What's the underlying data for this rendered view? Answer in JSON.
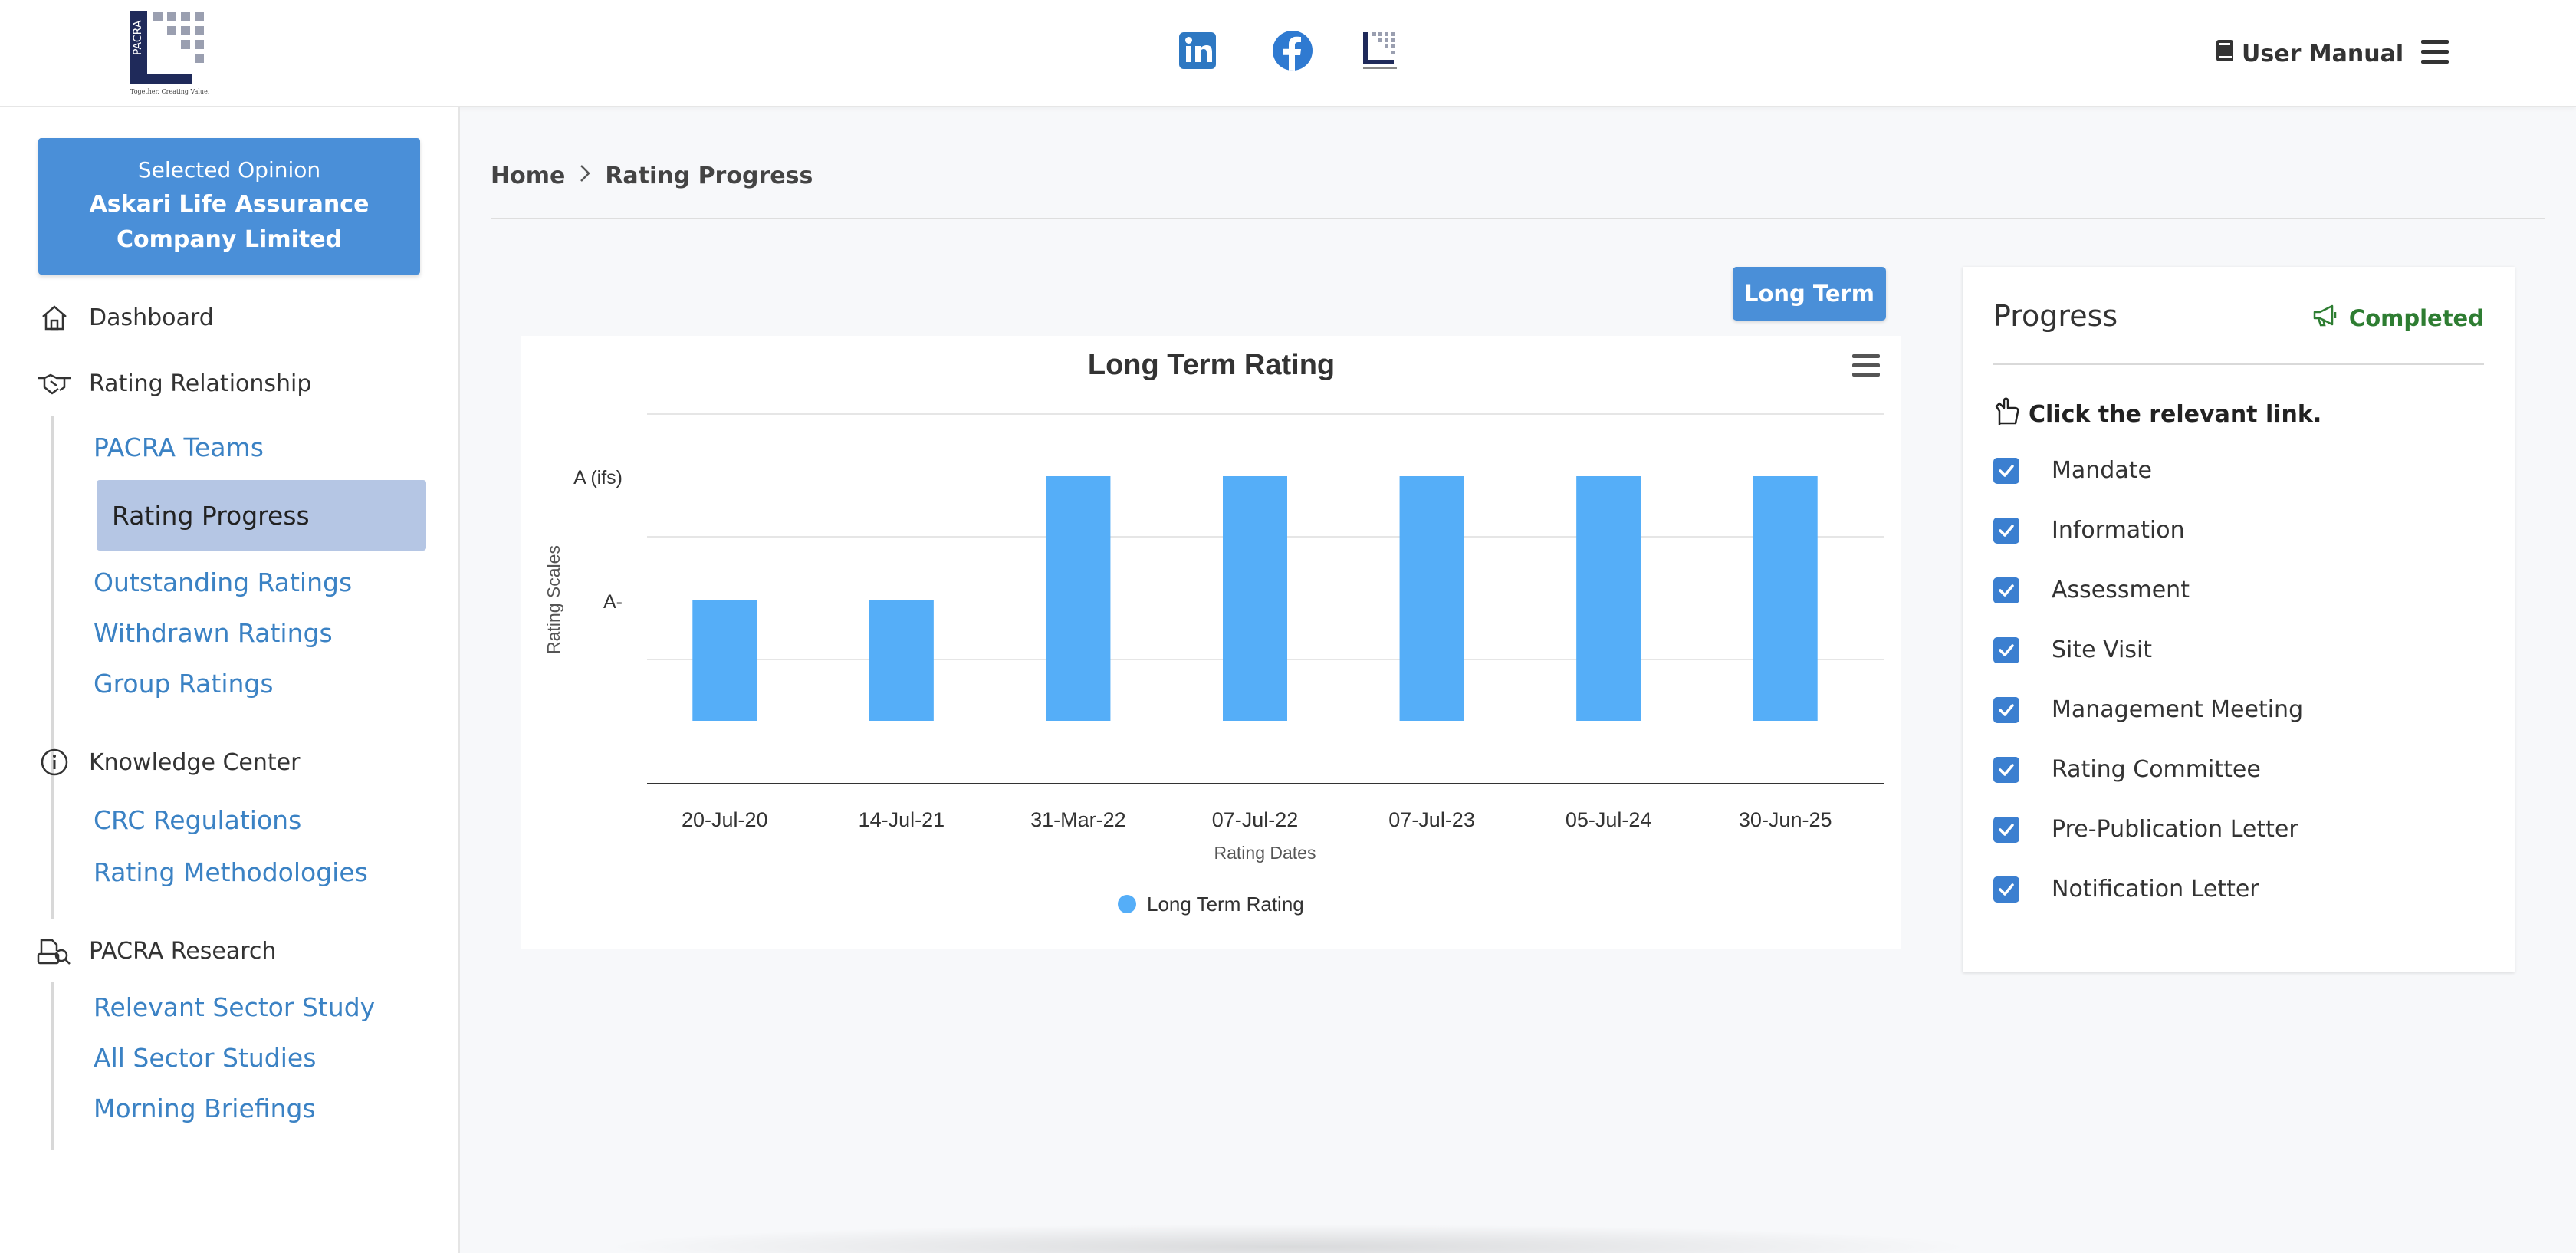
{
  "header": {
    "logo_text": "PACRA",
    "logo_tagline": "Together. Creating Value.",
    "user_manual_label": "User Manual"
  },
  "sidebar": {
    "selected_opinion_label": "Selected Opinion",
    "selected_opinion_name": "Askari Life Assurance Company Limited",
    "dashboard_label": "Dashboard",
    "rating_relationship": {
      "label": "Rating Relationship",
      "items": [
        "PACRA Teams",
        "Rating Progress",
        "Outstanding Ratings",
        "Withdrawn Ratings",
        "Group Ratings"
      ]
    },
    "knowledge_center": {
      "label": "Knowledge Center",
      "items": [
        "CRC Regulations",
        "Rating Methodologies"
      ]
    },
    "pacra_research": {
      "label": "PACRA Research",
      "items": [
        "Relevant Sector Study",
        "All Sector Studies",
        "Morning Briefings"
      ]
    }
  },
  "breadcrumb": {
    "home": "Home",
    "current": "Rating Progress"
  },
  "long_term_button": "Long Term",
  "chart_data": {
    "type": "bar",
    "title": "Long Term Rating",
    "xlabel": "Rating Dates",
    "ylabel": "Rating Scales",
    "categories": [
      "20-Jul-20",
      "14-Jul-21",
      "31-Mar-22",
      "07-Jul-22",
      "07-Jul-23",
      "05-Jul-24",
      "30-Jun-25"
    ],
    "y_tick_labels": [
      "A-",
      "A (ifs)"
    ],
    "series": [
      {
        "name": "Long Term Rating",
        "values": [
          "A-",
          "A-",
          "A (ifs)",
          "A (ifs)",
          "A (ifs)",
          "A (ifs)",
          "A (ifs)"
        ],
        "color": "#55aef8"
      }
    ],
    "legend_position": "bottom-center",
    "grid": true
  },
  "progress": {
    "title": "Progress",
    "status": "Completed",
    "status_color": "#2e7d32",
    "hint": "Click the relevant link.",
    "steps": [
      "Mandate",
      "Information",
      "Assessment",
      "Site Visit",
      "Management Meeting",
      "Rating Committee",
      "Pre-Publication Letter",
      "Notification Letter"
    ]
  }
}
